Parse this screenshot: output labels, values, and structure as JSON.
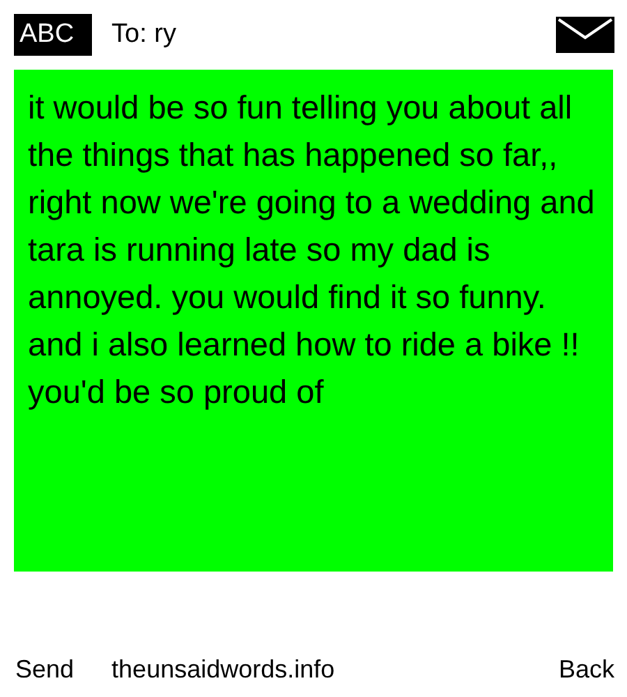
{
  "header": {
    "mode": "ABC",
    "recipient": "To: ry"
  },
  "message": {
    "text": "it would be so fun telling you about all the things that has happened so far,, right now we're going to a wedding and tara is running late so my dad is annoyed. you would find it so funny. and i also learned how to ride a bike !! you'd be so proud of"
  },
  "footer": {
    "left": "Send",
    "site": "theunsaidwords.info",
    "right": "Back"
  }
}
